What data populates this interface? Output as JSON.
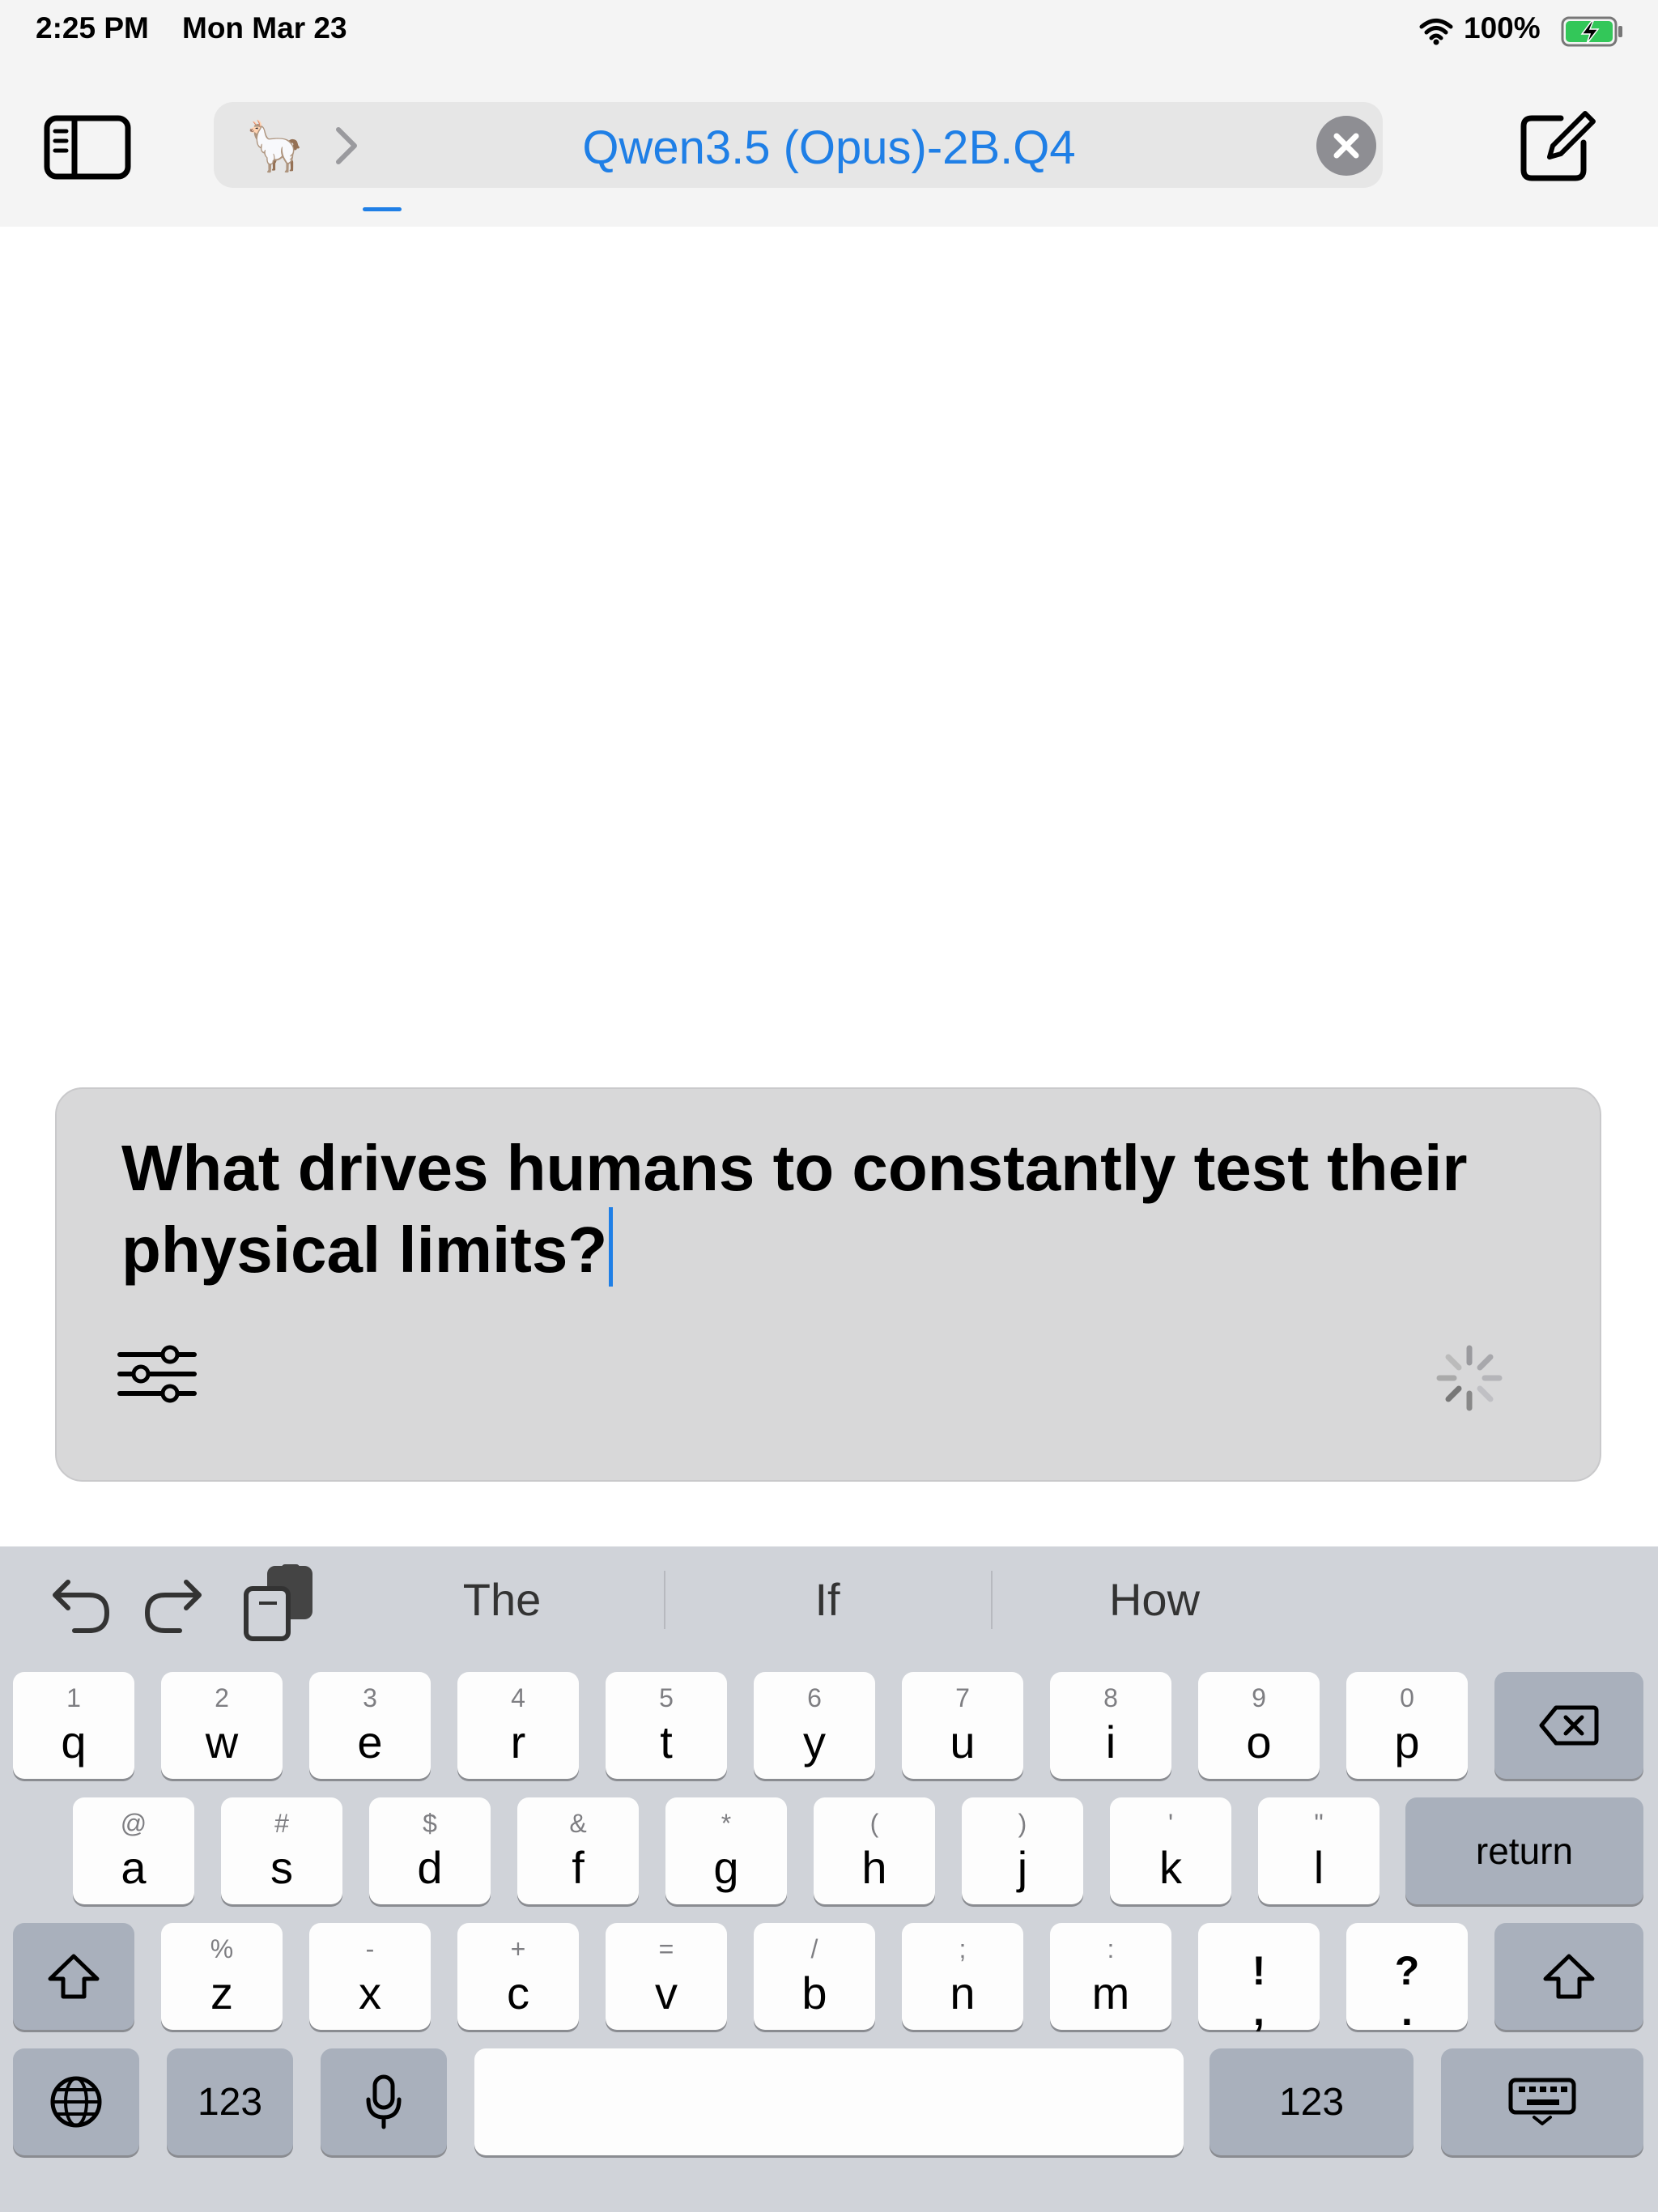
{
  "status_bar": {
    "time": "2:25 PM",
    "date": "Mon Mar 23",
    "battery_percent": "100%",
    "battery_level": 1.0,
    "charging": true,
    "wifi": "wifi-icon"
  },
  "nav": {
    "model_emoji": "🦙",
    "model_name": "Qwen3.5 (Opus)-2B.Q4",
    "icons": [
      "sidebar-toggle-icon",
      "llama-icon",
      "chevron-right-icon",
      "clear-icon",
      "compose-icon"
    ]
  },
  "input": {
    "text": "What drives humans to constantly test their physical limits?",
    "icons": [
      "settings-sliders-icon",
      "loading-spinner-icon"
    ]
  },
  "keyboard": {
    "suggestions": [
      "The",
      "If",
      "How"
    ],
    "row1": [
      {
        "hint": "1",
        "key": "q"
      },
      {
        "hint": "2",
        "key": "w"
      },
      {
        "hint": "3",
        "key": "e"
      },
      {
        "hint": "4",
        "key": "r"
      },
      {
        "hint": "5",
        "key": "t"
      },
      {
        "hint": "6",
        "key": "y"
      },
      {
        "hint": "7",
        "key": "u"
      },
      {
        "hint": "8",
        "key": "i"
      },
      {
        "hint": "9",
        "key": "o"
      },
      {
        "hint": "0",
        "key": "p"
      }
    ],
    "row2": [
      {
        "hint": "@",
        "key": "a"
      },
      {
        "hint": "#",
        "key": "s"
      },
      {
        "hint": "$",
        "key": "d"
      },
      {
        "hint": "&",
        "key": "f"
      },
      {
        "hint": "*",
        "key": "g"
      },
      {
        "hint": "(",
        "key": "h"
      },
      {
        "hint": ")",
        "key": "j"
      },
      {
        "hint": "'",
        "key": "k"
      },
      {
        "hint": "\"",
        "key": "l"
      }
    ],
    "row3": [
      {
        "hint": "%",
        "key": "z"
      },
      {
        "hint": "-",
        "key": "x"
      },
      {
        "hint": "+",
        "key": "c"
      },
      {
        "hint": "=",
        "key": "v"
      },
      {
        "hint": "/",
        "key": "b"
      },
      {
        "hint": ";",
        "key": "n"
      },
      {
        "hint": ":",
        "key": "m"
      }
    ],
    "punct": [
      {
        "top": "!",
        "bottom": ","
      },
      {
        "top": "?",
        "bottom": "."
      }
    ],
    "return_label": "return",
    "numbers_label": "123",
    "numbers_label_right": "123"
  }
}
